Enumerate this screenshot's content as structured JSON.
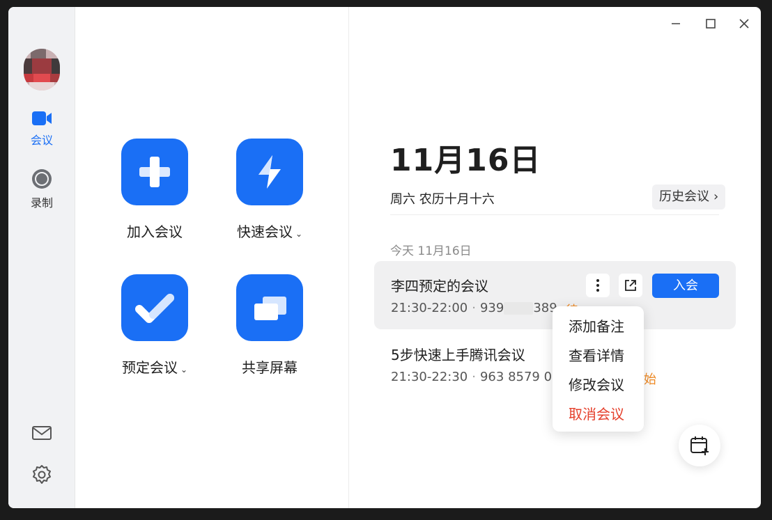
{
  "sidebar": {
    "items": [
      {
        "label": "会议",
        "icon": "video-camera-icon",
        "active": true
      },
      {
        "label": "录制",
        "icon": "record-icon",
        "active": false
      }
    ],
    "bottom_icons": [
      "mail-icon",
      "gear-icon"
    ]
  },
  "actions": [
    {
      "label": "加入会议",
      "icon": "plus-icon",
      "has_dropdown": false
    },
    {
      "label": "快速会议",
      "icon": "lightning-icon",
      "has_dropdown": true
    },
    {
      "label": "预定会议",
      "icon": "check-icon",
      "has_dropdown": true
    },
    {
      "label": "共享屏幕",
      "icon": "screen-share-icon",
      "has_dropdown": false
    }
  ],
  "dropdown_chevron": "⌄",
  "header": {
    "date": "11月16日",
    "subtitle": "周六 农历十月十六",
    "history_label": "历史会议",
    "history_arrow": "›"
  },
  "today_label": "今天 11月16日",
  "meetings": [
    {
      "title": "李四预定的会议",
      "time": "21:30-22:00",
      "id_prefix": "939",
      "id_suffix": "389",
      "status_fragment": "待",
      "join_label": "入会"
    },
    {
      "title": "5步快速上手腾讯会议",
      "time": "21:30-22:30",
      "id": "963 8579 027",
      "status_fragment": "始"
    }
  ],
  "context_menu": [
    "添加备注",
    "查看详情",
    "修改会议",
    "取消会议"
  ],
  "colors": {
    "accent": "#1a6ff5",
    "danger": "#e5402c",
    "status": "#f08a24",
    "sidebar_bg": "#f1f2f4"
  },
  "window_controls": [
    "minimize-icon",
    "maximize-icon",
    "close-icon"
  ]
}
